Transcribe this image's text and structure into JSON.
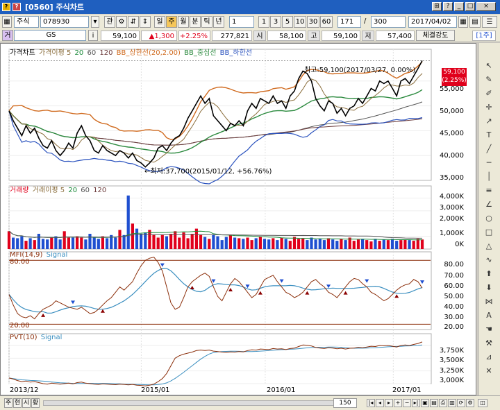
{
  "window": {
    "title": "[0560] 주식차트",
    "icons": [
      "app-icon",
      "help-icon"
    ],
    "buttons": [
      "⊞",
      "?",
      "_",
      "□",
      "×"
    ]
  },
  "toolbar1": {
    "market": "주식",
    "code": "078930",
    "btn_gwan": "관",
    "btn_gear": "⚙",
    "btn_arrows": "⇵",
    "periods": [
      "일",
      "주",
      "월",
      "분",
      "틱",
      "년"
    ],
    "selected_period": "주",
    "interval": "1",
    "ranges": [
      "1",
      "3",
      "5",
      "10",
      "30",
      "60"
    ],
    "count": "171",
    "count_sep": "/",
    "total": "300",
    "date": "2017/04/02"
  },
  "toolbar2": {
    "sel_flag": "거",
    "name": "GS",
    "info": "i",
    "price": "59,100",
    "change": "▲1,300",
    "pct": "+2.25%",
    "volume": "277,821",
    "open_label": "시",
    "open": "58,100",
    "high_label": "고",
    "high": "59,100",
    "low_label": "저",
    "low": "57,400",
    "strength": "체결강도",
    "unit": "1주"
  },
  "colors": {
    "up": "#e0001b",
    "down": "#1f4fd0",
    "bb": "#d06a1e",
    "bb_mid": "#2b8a3e",
    "bb_low": "#2a52be",
    "ma5": "#8a6d3b",
    "ma20": "#1b8a3a",
    "ma60": "#555555",
    "ma120": "#6b3a3a"
  },
  "price_panel": {
    "legend": [
      "가격차트",
      "가격이평 5",
      "20",
      "60",
      "120",
      "BB_상한선(20,2.00)",
      "BB_중심선",
      "BB_하한선"
    ],
    "annot_high": "최고:59,100(2017/03/27, 0.00%)",
    "annot_low": "←최저:37,700(2015/01/12, +56.76%)",
    "current_price": "59,100",
    "current_pct": "(2.25%)",
    "yticks": [
      "55,000",
      "50,000",
      "45,000",
      "40,000",
      "35,000"
    ]
  },
  "volume_panel": {
    "legend": [
      "거래량",
      "거래이평 5",
      "20",
      "60",
      "120"
    ],
    "yticks": [
      "4,000K",
      "3,000K",
      "2,000K",
      "1,000K",
      "0K"
    ]
  },
  "mfi_panel": {
    "legend": [
      "MFI(14,9)",
      "Signal"
    ],
    "level_high": "80.00",
    "level_low": "20.00",
    "yticks": [
      "80.00",
      "70.00",
      "60.00",
      "50.00",
      "40.00",
      "30.00",
      "20.00"
    ]
  },
  "pvt_panel": {
    "legend": [
      "PVT(10)",
      "Signal"
    ],
    "yticks": [
      "3,750K",
      "3,500K",
      "3,250K",
      "3,000K"
    ]
  },
  "xaxis": {
    "labels": [
      "2013/12",
      "2015/01",
      "2016/01",
      "2017/01"
    ]
  },
  "bottom": {
    "tabs": [
      "주",
      "현",
      "시",
      "황"
    ],
    "num": "150"
  },
  "chart_data": {
    "type": "line",
    "title": "",
    "x_labels": [
      "2013/12",
      "2015/01",
      "2016/01",
      "2017/01"
    ],
    "price_ylim": [
      35000,
      60000
    ],
    "close_weekly": [
      49000,
      47000,
      45500,
      44000,
      46000,
      44500,
      45500,
      43500,
      42000,
      41500,
      43000,
      41000,
      40000,
      41000,
      42500,
      41500,
      44500,
      46000,
      44000,
      43000,
      41000,
      40500,
      42000,
      41000,
      40500,
      40000,
      41000,
      40500,
      39500,
      40500,
      39000,
      38500,
      37700,
      38500,
      39500,
      41500,
      42000,
      41000,
      42500,
      43500,
      44000,
      45500,
      47500,
      49000,
      50500,
      52000,
      50500,
      51500,
      48000,
      47000,
      46000,
      45000,
      46500,
      46000,
      47000,
      46000,
      49000,
      50500,
      49500,
      51500,
      51000,
      50500,
      52000,
      50500,
      51000,
      49500,
      52000,
      53000,
      55500,
      57000,
      56500,
      55000,
      51500,
      50000,
      49000,
      51000,
      50500,
      48500,
      49500,
      48000,
      49500,
      50000,
      51500,
      50500,
      52000,
      53500,
      53000,
      55000,
      54500,
      55000,
      53500,
      52000,
      55000,
      55500,
      54500,
      56000,
      57500,
      59100
    ],
    "volume_weekly_k": [
      1400,
      900,
      850,
      1000,
      650,
      850,
      700,
      1200,
      800,
      750,
      900,
      1000,
      750,
      1400,
      900,
      900,
      1000,
      900,
      750,
      1200,
      900,
      800,
      1000,
      850,
      1100,
      900,
      1500,
      1100,
      4200,
      2000,
      1600,
      1200,
      1300,
      1500,
      1100,
      900,
      1100,
      1000,
      1200,
      1400,
      900,
      1300,
      850,
      1200,
      1600,
      1100,
      950,
      800,
      1100,
      1000,
      700,
      950,
      1100,
      900,
      850,
      800,
      900,
      700,
      850,
      950,
      800,
      750,
      850,
      700,
      900,
      800,
      650,
      950,
      800,
      850,
      700,
      900,
      750,
      800,
      700,
      850,
      750,
      650,
      800,
      700,
      900,
      650,
      750,
      800,
      700,
      600,
      800,
      650,
      750,
      700,
      800,
      650,
      700,
      750,
      700,
      650,
      800,
      750
    ],
    "mfi_weekly": [
      48,
      38,
      30,
      27,
      26,
      28,
      25,
      30,
      34,
      36,
      38,
      42,
      40,
      38,
      36,
      35,
      34,
      36,
      33,
      30,
      31,
      34,
      38,
      42,
      45,
      50,
      55,
      52,
      56,
      60,
      68,
      75,
      80,
      82,
      83,
      78,
      70,
      55,
      40,
      34,
      36,
      45,
      55,
      60,
      63,
      66,
      68,
      65,
      55,
      46,
      42,
      50,
      58,
      63,
      60,
      55,
      50,
      45,
      48,
      55,
      62,
      64,
      66,
      60,
      55,
      50,
      48,
      45,
      47,
      50,
      55,
      60,
      62,
      58,
      55,
      50,
      48,
      45,
      50,
      55,
      60,
      63,
      62,
      58,
      55,
      50,
      48,
      45,
      42,
      44,
      48,
      52,
      55,
      57,
      58,
      62,
      60,
      54
    ],
    "pvt_ylim": [
      3000,
      3900
    ],
    "pvt_weekly_k": [
      3110,
      3090,
      3060,
      3040,
      3050,
      3030,
      3040,
      3020,
      3000,
      2990,
      3010,
      3000,
      2990,
      3000,
      3010,
      2995,
      3020,
      3030,
      3010,
      3000,
      2990,
      2985,
      2995,
      2990,
      2985,
      2980,
      2990,
      2985,
      2975,
      2985,
      2970,
      2965,
      2955,
      2970,
      2990,
      3040,
      3100,
      3200,
      3350,
      3500,
      3550,
      3580,
      3600,
      3620,
      3650,
      3660,
      3650,
      3660,
      3640,
      3630,
      3620,
      3615,
      3625,
      3620,
      3630,
      3625,
      3650,
      3665,
      3660,
      3680,
      3675,
      3670,
      3690,
      3680,
      3685,
      3670,
      3690,
      3700,
      3730,
      3760,
      3755,
      3740,
      3710,
      3700,
      3690,
      3705,
      3700,
      3685,
      3695,
      3680,
      3695,
      3700,
      3715,
      3705,
      3720,
      3735,
      3730,
      3750,
      3745,
      3750,
      3735,
      3720,
      3750,
      3760,
      3750,
      3770,
      3790,
      3820
    ]
  }
}
